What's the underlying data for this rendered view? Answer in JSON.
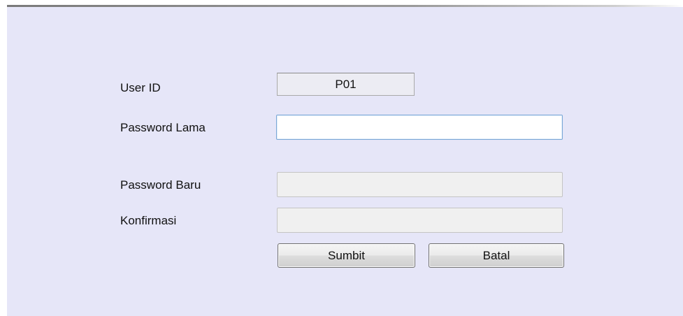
{
  "form": {
    "user_id_label": "User ID",
    "user_id_value": "P01",
    "old_password_label": "Password Lama",
    "old_password_value": "",
    "new_password_label": "Password Baru",
    "new_password_value": "",
    "confirm_label": "Konfirmasi",
    "confirm_value": "",
    "submit_label": "Sumbit",
    "cancel_label": "Batal"
  },
  "colors": {
    "panel_background": "#e6e6f8",
    "active_input_border": "#7aa7d6",
    "disabled_input_background": "#f0f0f0"
  }
}
